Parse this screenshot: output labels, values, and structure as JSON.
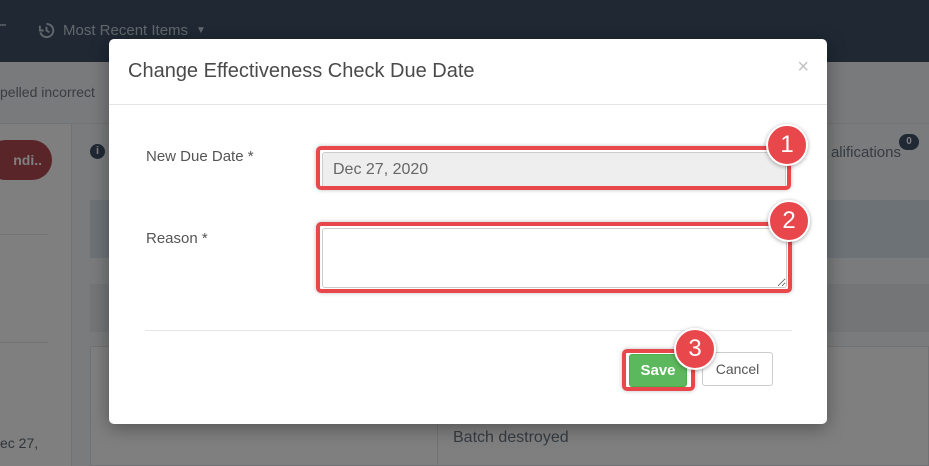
{
  "background": {
    "nav": {
      "most_recent_label": "Most Recent Items"
    },
    "message_fragment": "pelled incorrect",
    "left_pill_label": "ndi..",
    "left_date_fragment": "ec 27,",
    "qualifications_label": "alifications",
    "qualifications_count": "0",
    "batch_text": "Batch destroyed"
  },
  "modal": {
    "title": "Change Effectiveness Check Due Date",
    "close_symbol": "×",
    "fields": {
      "due_date_label": "New Due Date *",
      "due_date_value": "Dec 27, 2020",
      "reason_label": "Reason *",
      "reason_value": ""
    },
    "buttons": {
      "save": "Save",
      "cancel": "Cancel"
    }
  },
  "annotations": {
    "steps": [
      "1",
      "2",
      "3"
    ],
    "color": "#e8474c"
  },
  "colors": {
    "nav_bg": "#3e5166",
    "save_green": "#5cb85c"
  }
}
